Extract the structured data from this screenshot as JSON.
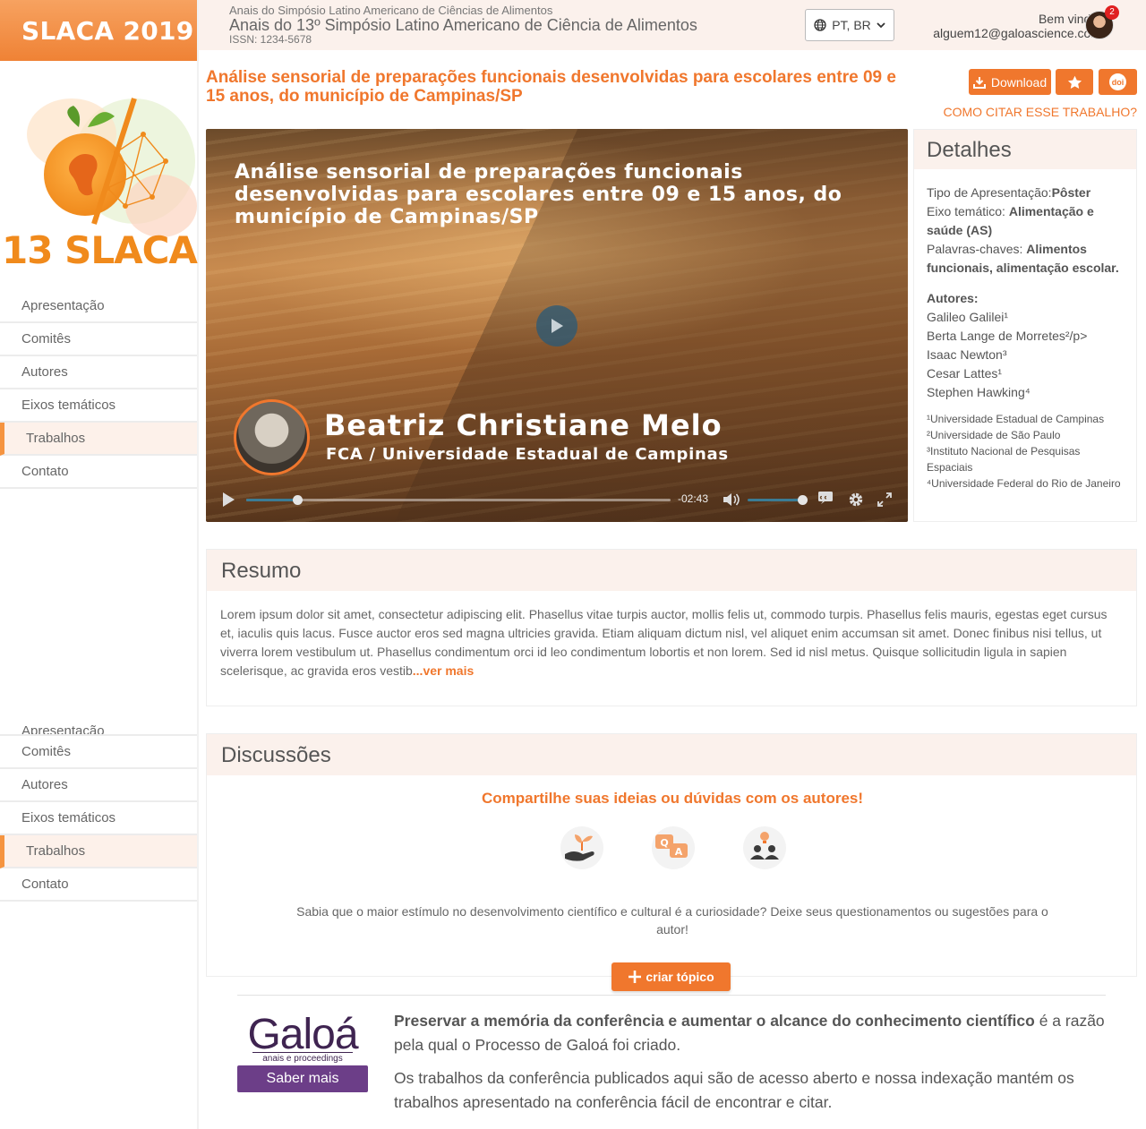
{
  "brand": "SLACA 2019",
  "logo": {
    "number": "13",
    "word": "SLACA"
  },
  "sidebar_nav": [
    {
      "label": "Apresentação"
    },
    {
      "label": "Comitês"
    },
    {
      "label": "Autores"
    },
    {
      "label": "Eixos temáticos"
    },
    {
      "label": "Trabalhos",
      "active": true
    },
    {
      "label": "Contato"
    }
  ],
  "header": {
    "line1": "Anais do Simpósio Latino Americano de Ciências de Alimentos",
    "line2": "Anais do 13º Simpósio Latino Americano de Ciência de Alimentos",
    "issn": "ISSN: 1234-5678",
    "language": "PT, BR",
    "welcome": "Bem vindo!",
    "email": "alguem12@galoascience.com",
    "notifications": "2"
  },
  "paper": {
    "title": "Análise sensorial de preparações funcionais desenvolvidas para escolares entre 09 e 15 anos, do município de Campinas/SP",
    "download_label": "Download",
    "doi_label": "doi",
    "cite_label": "COMO CITAR ESSE TRABALHO?"
  },
  "video": {
    "title": "Análise sensorial de preparações funcionais desenvolvidas para escolares entre 09 e 15 anos, do município de Campinas/SP",
    "presenter": "Beatriz Christiane Melo",
    "affiliation": "FCA / Universidade Estadual de Campinas",
    "time_remaining": "-02:43",
    "progress": 0.12,
    "volume": 1.0
  },
  "details": {
    "heading": "Detalhes",
    "type_label": "Tipo de Apresentação:",
    "type_value": "Pôster",
    "axis_label": "Eixo temático: ",
    "axis_value": "Alimentação e saúde (AS)",
    "keywords_label": "Palavras-chaves: ",
    "keywords_value": "Alimentos funcionais, alimentação escolar.",
    "authors_heading": "Autores:",
    "authors": [
      "Galileo Galilei¹",
      "Berta Lange de Morretes²/p>",
      "Isaac Newton³",
      "Cesar Lattes¹",
      "Stephen Hawking⁴"
    ],
    "affiliations": [
      "¹Universidade Estadual de Campinas",
      "²Universidade de São Paulo",
      "³Instituto Nacional de Pesquisas Espaciais",
      "⁴Universidade Federal do Rio de Janeiro"
    ]
  },
  "resumo": {
    "heading": "Resumo",
    "text": "Lorem ipsum dolor sit amet, consectetur adipiscing elit. Phasellus vitae turpis auctor, mollis felis ut, commodo turpis. Phasellus felis mauris, egestas eget cursus et, iaculis quis lacus. Fusce auctor eros sed magna ultricies gravida. Etiam aliquam dictum nisl, vel aliquet enim accumsan sit amet. Donec finibus nisi tellus, ut viverra lorem vestibulum ut. Phasellus condimentum orci id leo condimentum lobortis et non lorem. Sed id nisl metus. Quisque sollicitudin ligula in sapien scelerisque, ac gravida eros vestib",
    "more": "...ver mais"
  },
  "discussoes": {
    "heading": "Discussões",
    "subtitle": "Compartilhe suas ideias ou dúvidas com os autores!",
    "qa_q": "Q",
    "qa_a": "A",
    "text": "Sabia que o maior estímulo no desenvolvimento científico e cultural é a curiosidade? Deixe seus questionamentos ou sugestões para o autor!",
    "create_label": "criar tópico"
  },
  "footer": {
    "logo_word": "Galoá",
    "logo_tag": "anais e proceedings",
    "button": "Saber mais",
    "p1_bold": "Preservar a memória da conferência e aumentar o alcance do conhecimento científico",
    "p1_rest": " é a razão pela qual o Processo de Galoá foi criado.",
    "p2": "Os trabalhos da conferência publicados aqui são de acesso aberto e nossa indexação mantém os trabalhos apresentado na conferência fácil de encontrar e citar."
  },
  "colors": {
    "accent": "#f0772d",
    "header_bg": "#fbf1ec",
    "galoa": "#3f2451"
  }
}
